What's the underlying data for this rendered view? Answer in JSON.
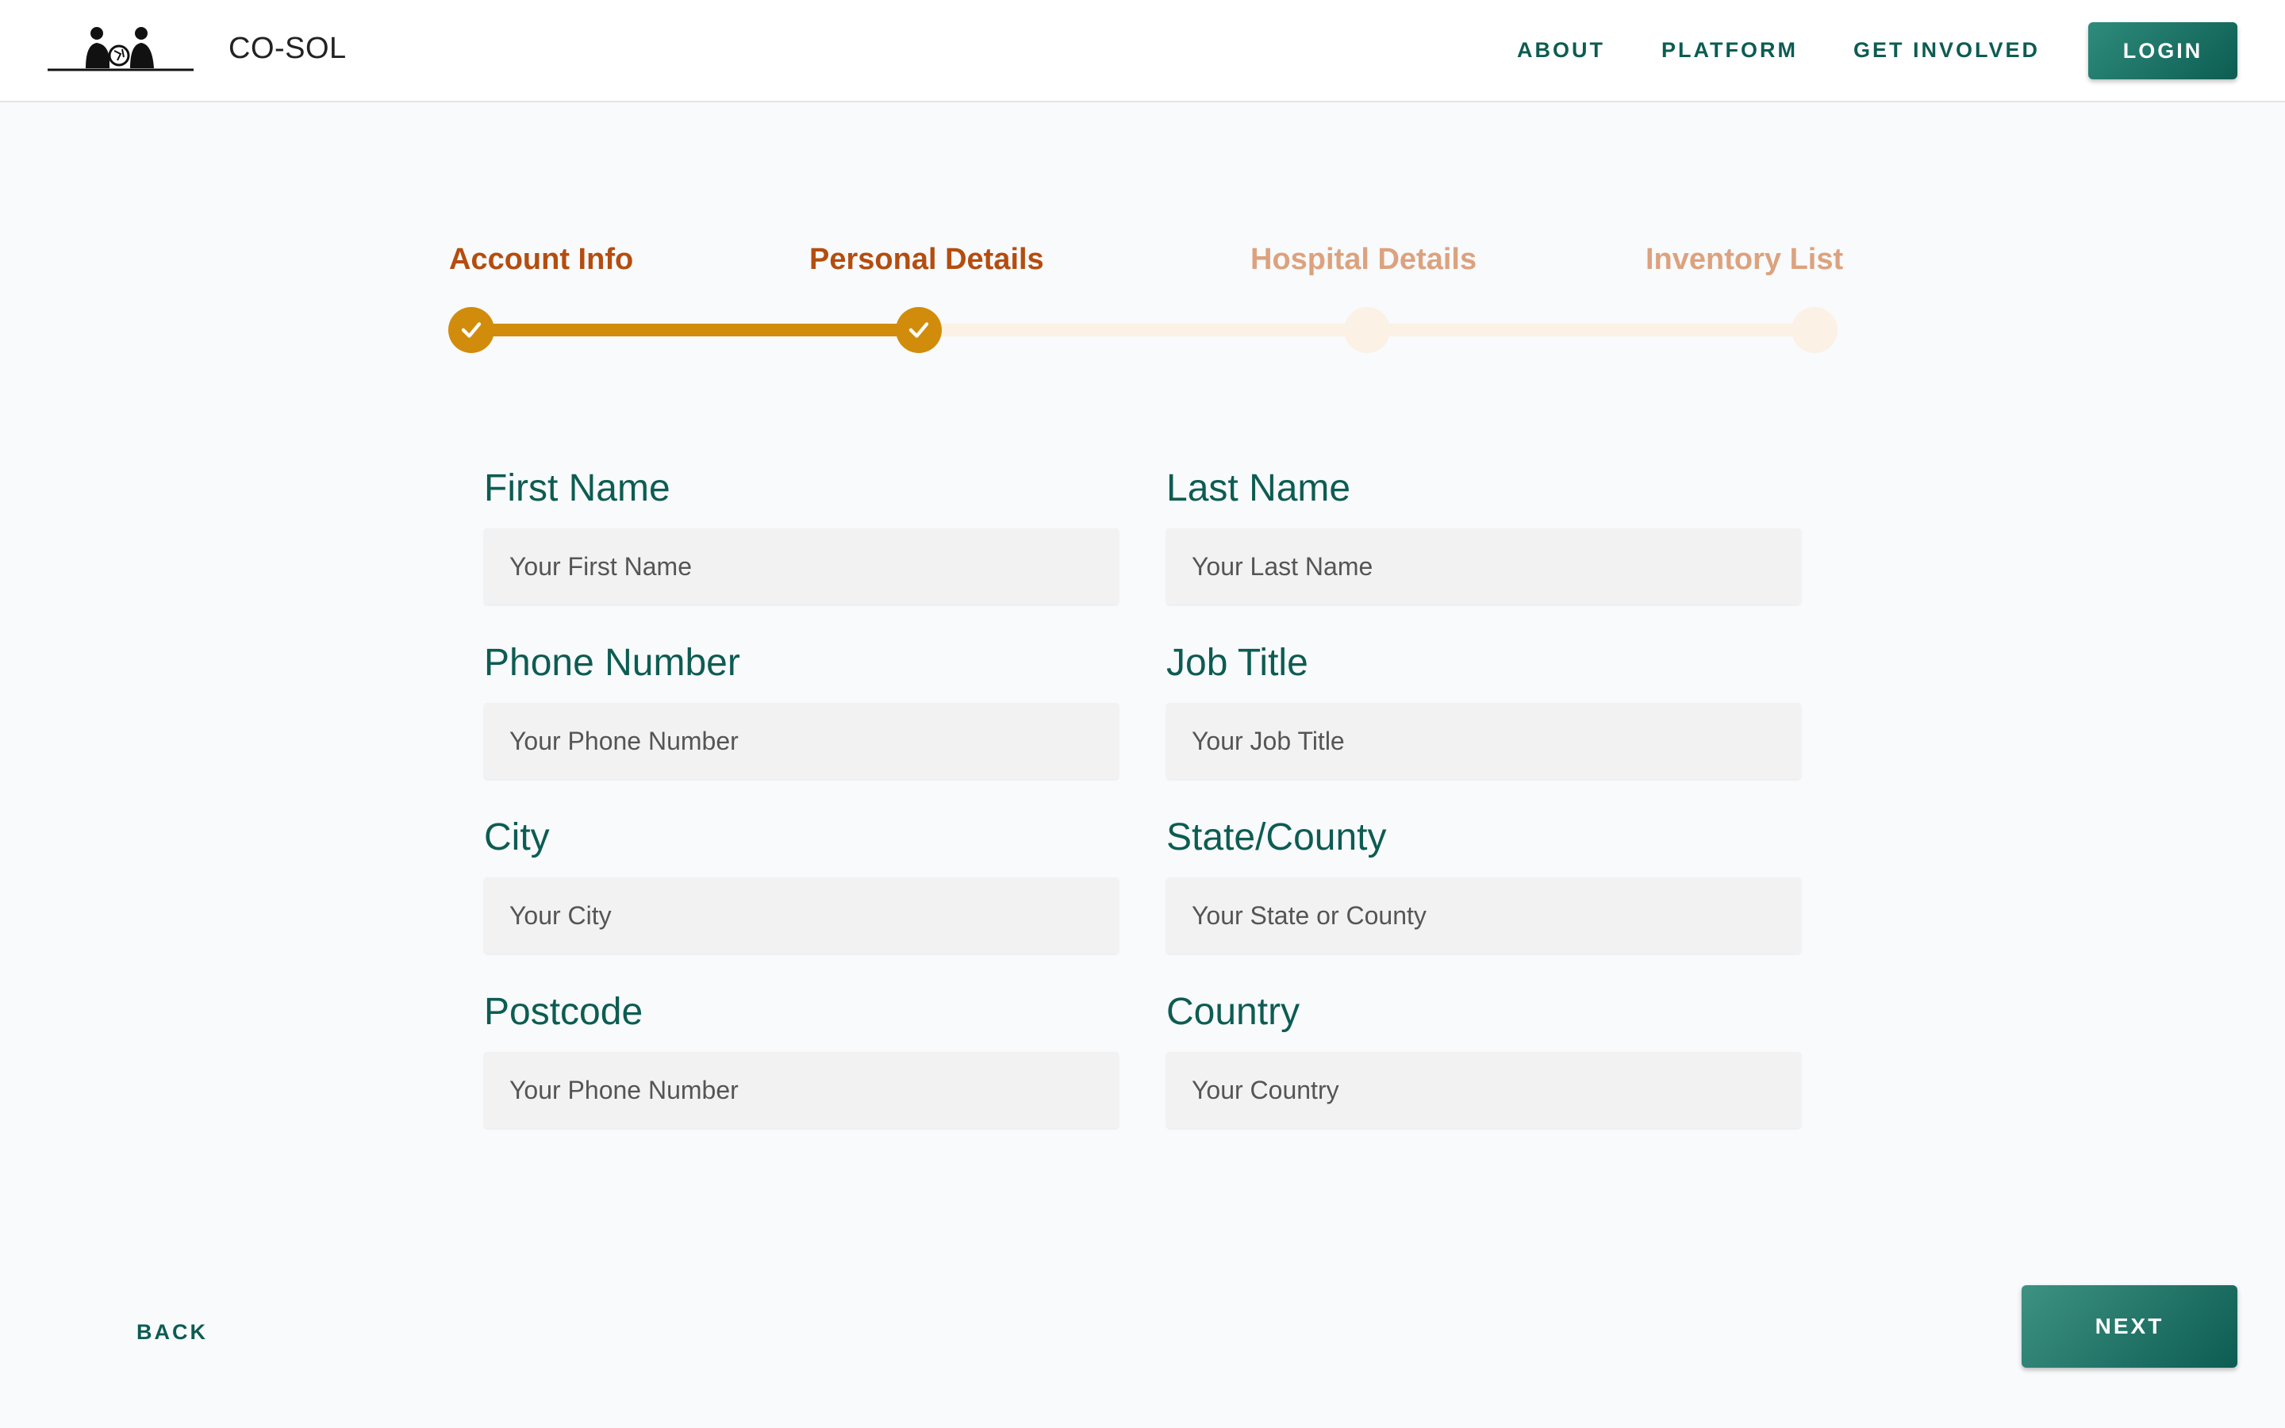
{
  "header": {
    "brand": "CO-SOL",
    "nav": [
      {
        "label": "ABOUT"
      },
      {
        "label": "PLATFORM"
      },
      {
        "label": "GET INVOLVED"
      }
    ],
    "login_label": "LOGIN"
  },
  "stepper": {
    "current_step": 2,
    "steps": [
      {
        "label": "Account Info",
        "status": "complete"
      },
      {
        "label": "Personal Details",
        "status": "complete"
      },
      {
        "label": "Hospital Details",
        "status": "incomplete"
      },
      {
        "label": "Inventory List",
        "status": "incomplete"
      }
    ]
  },
  "form": {
    "fields": [
      {
        "label": "First Name",
        "placeholder": "Your First Name",
        "value": ""
      },
      {
        "label": "Last Name",
        "placeholder": "Your Last Name",
        "value": ""
      },
      {
        "label": "Phone Number",
        "placeholder": "Your Phone Number",
        "value": ""
      },
      {
        "label": "Job Title",
        "placeholder": "Your Job Title",
        "value": ""
      },
      {
        "label": "City",
        "placeholder": "Your City",
        "value": ""
      },
      {
        "label": "State/County",
        "placeholder": "Your State or County",
        "value": ""
      },
      {
        "label": "Postcode",
        "placeholder": "Your Phone Number",
        "value": ""
      },
      {
        "label": "Country",
        "placeholder": "Your Country",
        "value": ""
      }
    ]
  },
  "footer": {
    "back_label": "BACK",
    "next_label": "NEXT"
  },
  "colors": {
    "primary": "#0d5c52",
    "accent": "#d18c0c",
    "step_done_text": "#b44d0f",
    "step_todo_text": "#dca27e",
    "track_empty": "#fbf1e4"
  },
  "icons": {
    "logo": "people-group-logo",
    "step_check": "check-icon"
  }
}
